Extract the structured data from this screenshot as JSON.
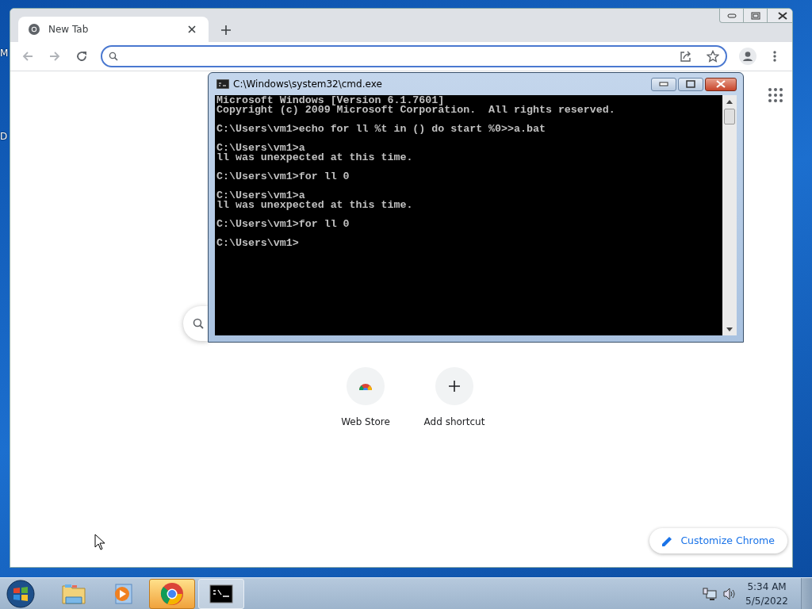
{
  "desktop_icons": [
    {
      "label": "M"
    },
    {
      "label": "D"
    }
  ],
  "chrome": {
    "tabs": [
      {
        "title": "New Tab",
        "selected": true
      }
    ],
    "shortcuts": [
      {
        "label": "Web Store",
        "kind": "webstore"
      },
      {
        "label": "Add shortcut",
        "kind": "add"
      }
    ],
    "customize_button": "Customize Chrome"
  },
  "cmd": {
    "title": "C:\\Windows\\system32\\cmd.exe",
    "blocks": [
      [
        "Microsoft Windows [Version 6.1.7601]",
        "Copyright (c) 2009 Microsoft Corporation.  All rights reserved."
      ],
      [
        "C:\\Users\\vm1>echo for ll %t in () do start %0>>a.bat"
      ],
      [
        "C:\\Users\\vm1>a",
        "ll was unexpected at this time."
      ],
      [
        "C:\\Users\\vm1>for ll 0"
      ],
      [
        "C:\\Users\\vm1>a",
        "ll was unexpected at this time."
      ],
      [
        "C:\\Users\\vm1>for ll 0"
      ],
      [
        "C:\\Users\\vm1>"
      ]
    ]
  },
  "taskbar": {
    "items": [
      {
        "kind": "explorer",
        "open": false,
        "selected": false
      },
      {
        "kind": "media",
        "open": false,
        "selected": false
      },
      {
        "kind": "chrome",
        "open": true,
        "selected": true
      },
      {
        "kind": "cmd",
        "open": true,
        "selected": false
      }
    ],
    "clock": {
      "time": "5:34 AM",
      "date": "5/5/2022"
    }
  }
}
